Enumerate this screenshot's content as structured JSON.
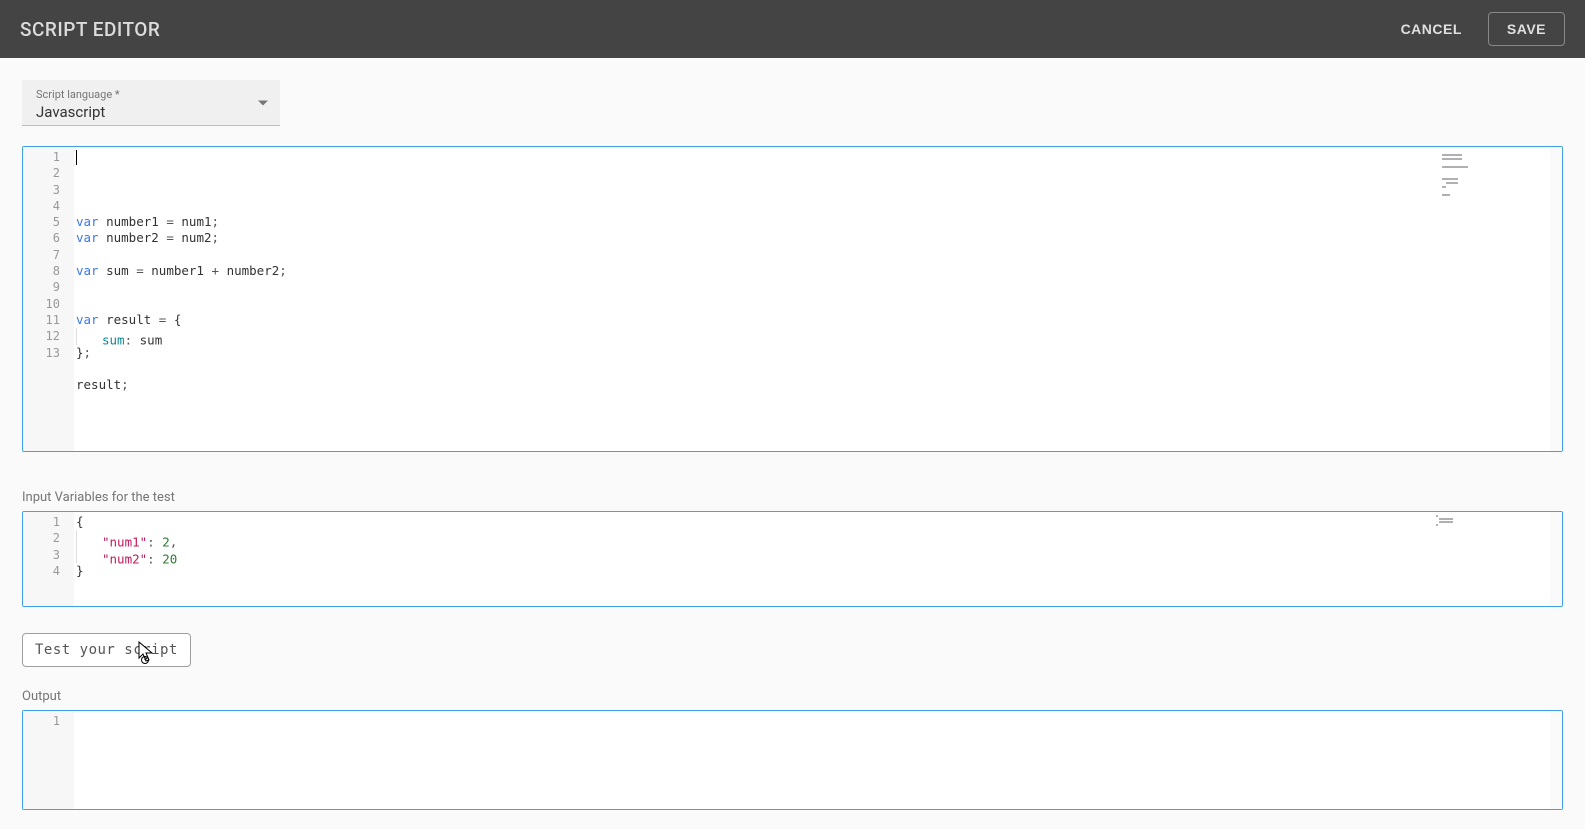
{
  "header": {
    "title": "SCRIPT EDITOR",
    "cancel": "CANCEL",
    "save": "SAVE"
  },
  "language": {
    "label": "Script language *",
    "value": "Javascript"
  },
  "code": {
    "lines": [
      "",
      "var number1 = num1;",
      "var number2 = num2;",
      "",
      "var sum = number1 + number2;",
      "",
      "",
      "var result = {",
      "    sum: sum",
      "};",
      "",
      "result;",
      ""
    ],
    "tokens": [
      [],
      [
        {
          "t": "kw",
          "v": "var"
        },
        {
          "t": "sp",
          "v": " "
        },
        {
          "t": "id",
          "v": "number1"
        },
        {
          "t": "sp",
          "v": " "
        },
        {
          "t": "punc",
          "v": "="
        },
        {
          "t": "sp",
          "v": " "
        },
        {
          "t": "id",
          "v": "num1"
        },
        {
          "t": "punc",
          "v": ";"
        }
      ],
      [
        {
          "t": "kw",
          "v": "var"
        },
        {
          "t": "sp",
          "v": " "
        },
        {
          "t": "id",
          "v": "number2"
        },
        {
          "t": "sp",
          "v": " "
        },
        {
          "t": "punc",
          "v": "="
        },
        {
          "t": "sp",
          "v": " "
        },
        {
          "t": "id",
          "v": "num2"
        },
        {
          "t": "punc",
          "v": ";"
        }
      ],
      [],
      [
        {
          "t": "kw",
          "v": "var"
        },
        {
          "t": "sp",
          "v": " "
        },
        {
          "t": "id",
          "v": "sum"
        },
        {
          "t": "sp",
          "v": " "
        },
        {
          "t": "punc",
          "v": "="
        },
        {
          "t": "sp",
          "v": " "
        },
        {
          "t": "id",
          "v": "number1"
        },
        {
          "t": "sp",
          "v": " "
        },
        {
          "t": "punc",
          "v": "+"
        },
        {
          "t": "sp",
          "v": " "
        },
        {
          "t": "id",
          "v": "number2"
        },
        {
          "t": "punc",
          "v": ";"
        }
      ],
      [],
      [],
      [
        {
          "t": "kw",
          "v": "var"
        },
        {
          "t": "sp",
          "v": " "
        },
        {
          "t": "id",
          "v": "result"
        },
        {
          "t": "sp",
          "v": " "
        },
        {
          "t": "punc",
          "v": "="
        },
        {
          "t": "sp",
          "v": " "
        },
        {
          "t": "brace",
          "v": "{"
        }
      ],
      [
        {
          "t": "indent",
          "v": "    "
        },
        {
          "t": "prop",
          "v": "sum"
        },
        {
          "t": "punc",
          "v": ":"
        },
        {
          "t": "sp",
          "v": " "
        },
        {
          "t": "id",
          "v": "sum"
        }
      ],
      [
        {
          "t": "brace",
          "v": "}"
        },
        {
          "t": "punc",
          "v": ";"
        }
      ],
      [],
      [
        {
          "t": "id",
          "v": "result"
        },
        {
          "t": "punc",
          "v": ";"
        }
      ],
      []
    ]
  },
  "inputVars": {
    "label": "Input Variables for the test",
    "lines": [
      "{",
      "    \"num1\": 2,",
      "    \"num2\": 20",
      "}"
    ],
    "tokens": [
      [
        {
          "t": "brace",
          "v": "{"
        }
      ],
      [
        {
          "t": "indent",
          "v": "    "
        },
        {
          "t": "str",
          "v": "\"num1\""
        },
        {
          "t": "punc",
          "v": ":"
        },
        {
          "t": "sp",
          "v": " "
        },
        {
          "t": "num",
          "v": "2"
        },
        {
          "t": "punc",
          "v": ","
        }
      ],
      [
        {
          "t": "indent",
          "v": "    "
        },
        {
          "t": "str",
          "v": "\"num2\""
        },
        {
          "t": "punc",
          "v": ":"
        },
        {
          "t": "sp",
          "v": " "
        },
        {
          "t": "num",
          "v": "20"
        }
      ],
      [
        {
          "t": "brace",
          "v": "}"
        }
      ]
    ]
  },
  "testButton": "Test your script",
  "output": {
    "label": "Output",
    "lines": [
      ""
    ]
  }
}
